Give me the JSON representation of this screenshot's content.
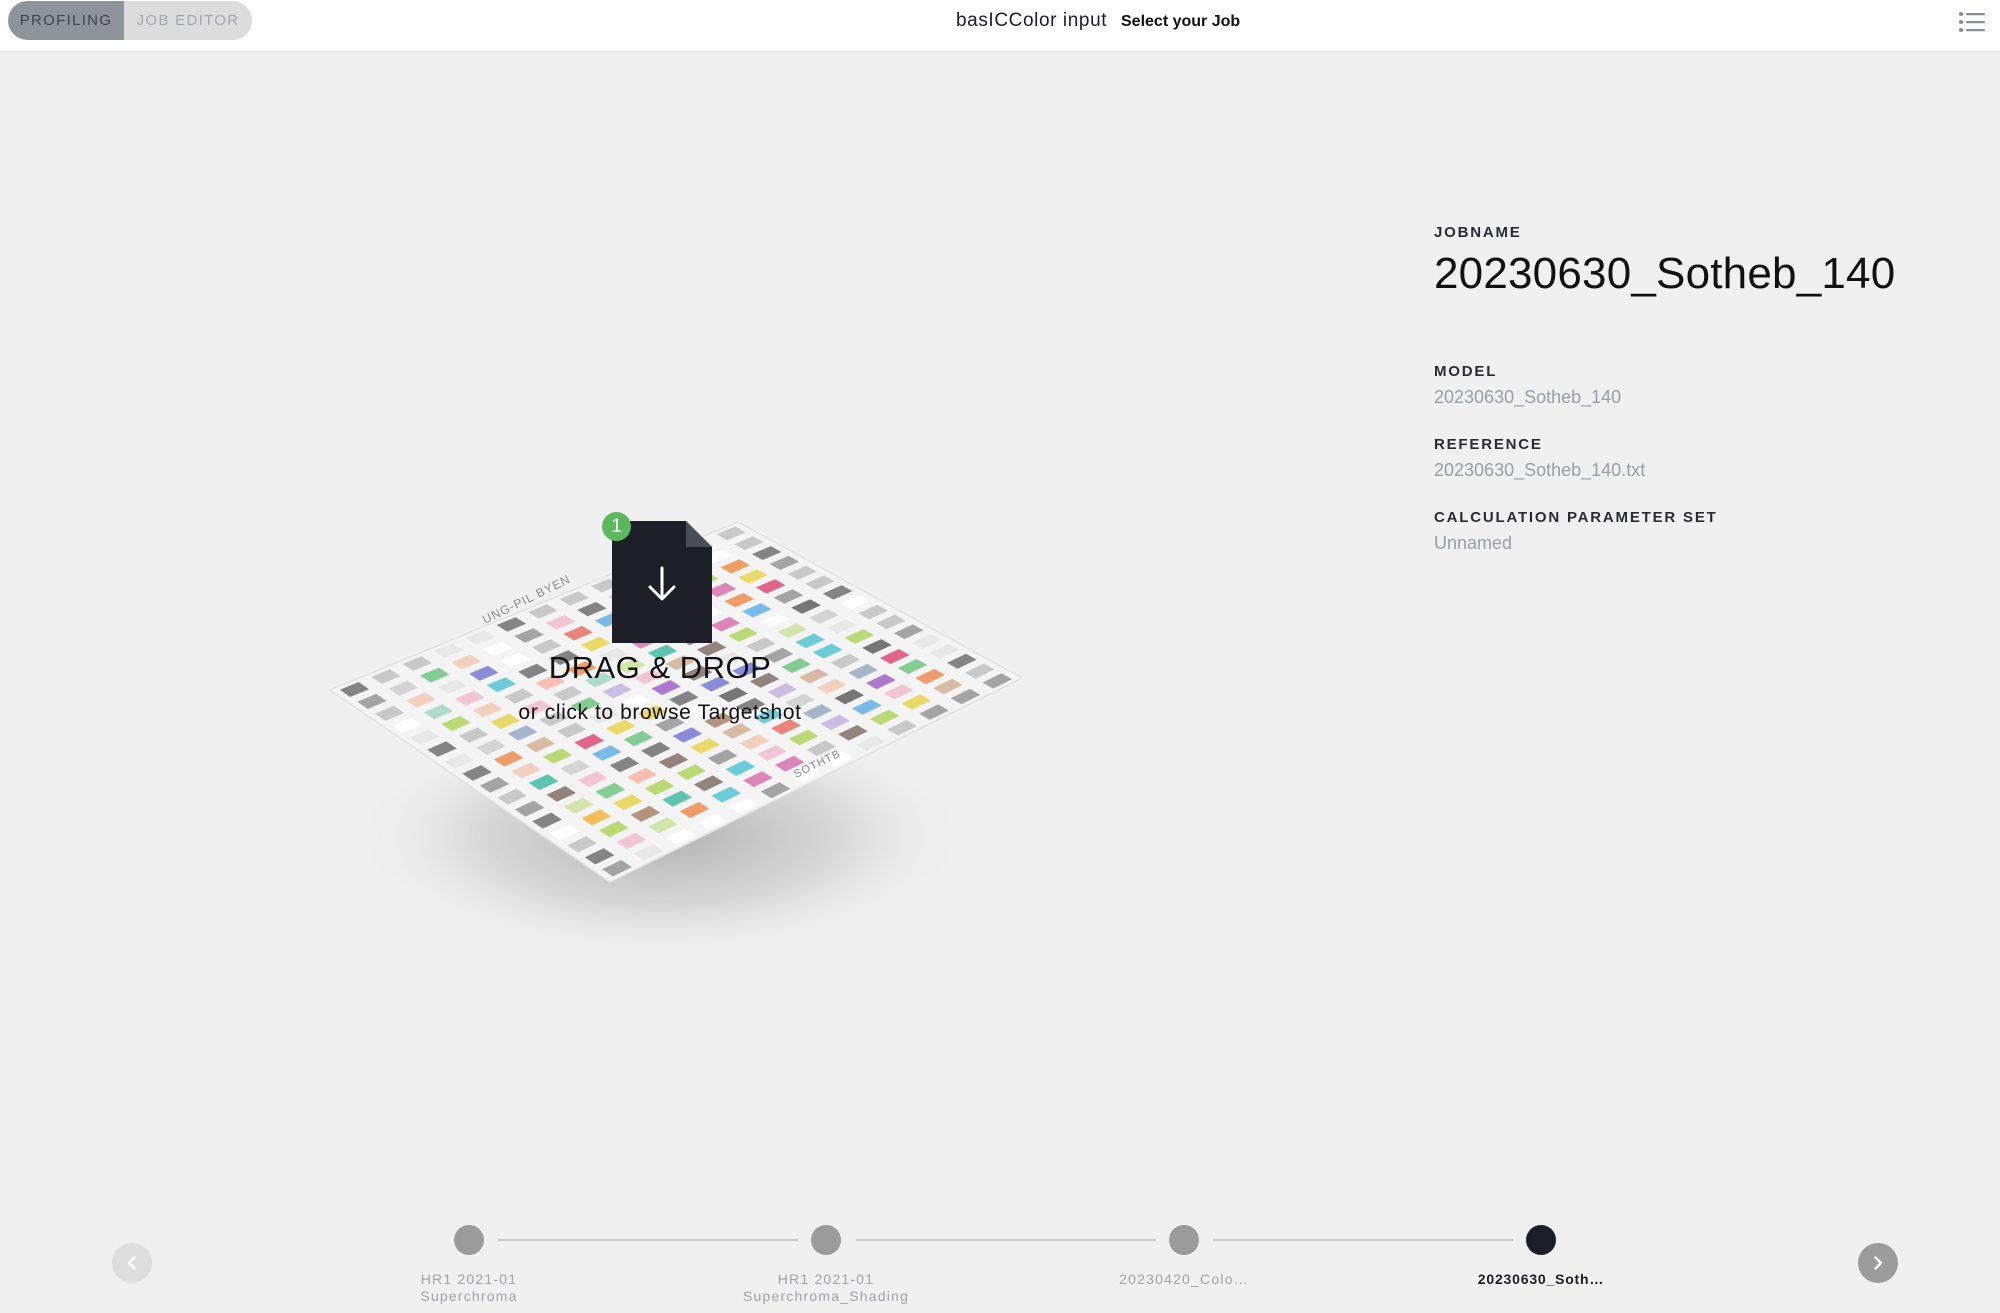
{
  "topbar": {
    "modes": [
      {
        "label": "PROFILING",
        "active": true
      },
      {
        "label": "JOB EDITOR",
        "active": false
      }
    ],
    "app_title": "basICColor input",
    "subtitle": "Select your Job"
  },
  "dropzone": {
    "badge": "1",
    "title": "DRAG & DROP",
    "subtitle": "or click to browse Targetshot",
    "chart_labels": [
      "UNG-PIL BYEN",
      "SOTHTB"
    ]
  },
  "job": {
    "jobname_label": "JOBNAME",
    "jobname": "20230630_Sotheb_140",
    "model_label": "MODEL",
    "model": "20230630_Sotheb_140",
    "reference_label": "REFERENCE",
    "reference": "20230630_Sotheb_140.txt",
    "calc_label": "CALCULATION PARAMETER SET",
    "calc": "Unnamed"
  },
  "timeline": {
    "items": [
      {
        "line1": "HR1 2021-01",
        "line2": "Superchroma"
      },
      {
        "line1": "HR1 2021-01",
        "line2": "Superchroma_Shading"
      },
      {
        "line1": "20230420_Colo…",
        "line2": ""
      },
      {
        "line1": "20230630_Soth…",
        "line2": ""
      }
    ],
    "active_index": 3
  },
  "colors": {
    "accent_dark": "#1c1e28",
    "badge_green": "#5cb85c",
    "muted_text": "#9a9ea5"
  },
  "icons": [
    "menu-list-icon",
    "file-download-icon",
    "chevron-left-icon",
    "chevron-right-icon"
  ]
}
